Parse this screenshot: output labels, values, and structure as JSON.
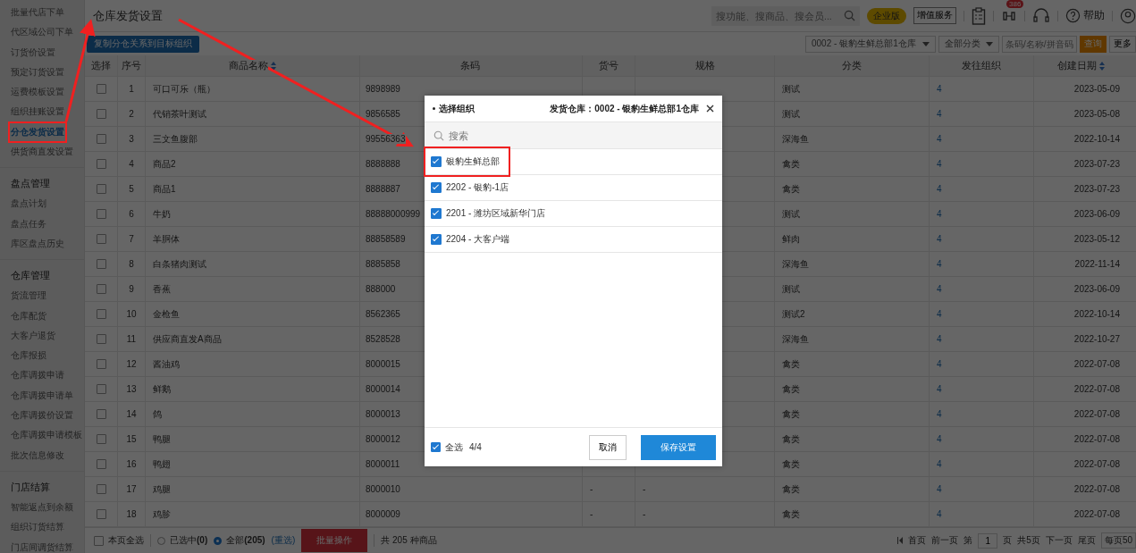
{
  "sidebar": {
    "groups": [
      {
        "items": [
          {
            "label": "批量代店下单",
            "selected": false
          },
          {
            "label": "代区域公司下单",
            "selected": false
          },
          {
            "label": "订货价设置",
            "selected": false
          },
          {
            "label": "预定订货设置",
            "selected": false
          },
          {
            "label": "运费模板设置",
            "selected": false
          },
          {
            "label": "组织挂账设置",
            "selected": false
          },
          {
            "label": "分仓发货设置",
            "selected": true
          },
          {
            "label": "供货商直发设置",
            "selected": false
          }
        ]
      },
      {
        "heading": "盘点管理",
        "items": [
          {
            "label": "盘点计划",
            "selected": false
          },
          {
            "label": "盘点任务",
            "selected": false
          },
          {
            "label": "库区盘点历史",
            "selected": false
          }
        ]
      },
      {
        "heading": "仓库管理",
        "items": [
          {
            "label": "货流管理",
            "selected": false
          },
          {
            "label": "仓库配货",
            "selected": false
          },
          {
            "label": "大客户退货",
            "selected": false
          },
          {
            "label": "仓库报损",
            "selected": false
          },
          {
            "label": "仓库调拨申请",
            "selected": false
          },
          {
            "label": "仓库调拨申请单",
            "selected": false
          },
          {
            "label": "仓库调拨价设置",
            "selected": false
          },
          {
            "label": "仓库调拨申请模板",
            "selected": false
          },
          {
            "label": "批次信息修改",
            "selected": false
          }
        ]
      },
      {
        "heading": "门店结算",
        "items": [
          {
            "label": "智能返点到余额",
            "selected": false
          },
          {
            "label": "组织订货结算",
            "selected": false
          },
          {
            "label": "门店间调货结算",
            "selected": false
          }
        ]
      }
    ]
  },
  "header": {
    "title": "仓库发货设置",
    "search": {
      "placeholder": "搜功能、搜商品、搜会员..."
    },
    "edition_badge": "企业版",
    "value_service": "增值服务",
    "notification_count": "386",
    "help": "帮助"
  },
  "toolbar": {
    "copy_button": "复制分仓关系到目标组织",
    "warehouse_select": "0002 - 银豹生鲜总部1仓库",
    "category_select": "全部分类",
    "keyword": {
      "placeholder": "条码/名称/拼音码"
    },
    "query_button": "查询",
    "more_button": "更多"
  },
  "table": {
    "columns": [
      "选择",
      "序号",
      "商品名称",
      "条码",
      "货号",
      "规格",
      "分类",
      "发往组织",
      "创建日期"
    ],
    "rows": [
      {
        "checked": false,
        "no": "1",
        "name": "可口可乐（瓶）",
        "barcode": "9898989",
        "category": "测试",
        "org": "4",
        "date": "2023-05-09"
      },
      {
        "checked": false,
        "no": "2",
        "name": "代销茶叶测试",
        "barcode": "9856585",
        "category": "测试",
        "org": "4",
        "date": "2023-05-08"
      },
      {
        "checked": false,
        "no": "3",
        "name": "三文鱼腹部",
        "barcode": "99556363",
        "category": "深海鱼",
        "org": "4",
        "date": "2022-10-14"
      },
      {
        "checked": false,
        "no": "4",
        "name": "商品2",
        "barcode": "8888888",
        "category": "禽类",
        "org": "4",
        "date": "2023-07-23"
      },
      {
        "checked": false,
        "no": "5",
        "name": "商品1",
        "barcode": "8888887",
        "category": "禽类",
        "org": "4",
        "date": "2023-07-23"
      },
      {
        "checked": false,
        "no": "6",
        "name": "牛奶",
        "barcode": "88888000999",
        "category": "测试",
        "org": "4",
        "date": "2023-06-09"
      },
      {
        "checked": false,
        "no": "7",
        "name": "羊胴体",
        "barcode": "88858589",
        "category": "鲜肉",
        "org": "4",
        "date": "2023-05-12"
      },
      {
        "checked": false,
        "no": "8",
        "name": "白条猪肉测试",
        "barcode": "8885858",
        "category": "深海鱼",
        "org": "4",
        "date": "2022-11-14"
      },
      {
        "checked": false,
        "no": "9",
        "name": "香蕉",
        "barcode": "888000",
        "category": "测试",
        "org": "4",
        "date": "2023-06-09"
      },
      {
        "checked": false,
        "no": "10",
        "name": "金枪鱼",
        "barcode": "8562365",
        "category": "测试2",
        "org": "4",
        "date": "2022-10-14"
      },
      {
        "checked": false,
        "no": "11",
        "name": "供应商直发A商品",
        "barcode": "8528528",
        "category": "深海鱼",
        "org": "4",
        "date": "2022-10-27"
      },
      {
        "checked": false,
        "no": "12",
        "name": "酱油鸡",
        "barcode": "8000015",
        "category": "禽类",
        "org": "4",
        "date": "2022-07-08"
      },
      {
        "checked": false,
        "no": "13",
        "name": "鲜鹅",
        "barcode": "8000014",
        "category": "禽类",
        "org": "4",
        "date": "2022-07-08"
      },
      {
        "checked": false,
        "no": "14",
        "name": "鸽",
        "barcode": "8000013",
        "category": "禽类",
        "org": "4",
        "date": "2022-07-08"
      },
      {
        "checked": false,
        "no": "15",
        "name": "鸭腿",
        "barcode": "8000012",
        "category": "禽类",
        "org": "4",
        "date": "2022-07-08"
      },
      {
        "checked": false,
        "no": "16",
        "name": "鸭翅",
        "barcode": "8000011",
        "category": "禽类",
        "org": "4",
        "date": "2022-07-08"
      },
      {
        "checked": false,
        "no": "17",
        "name": "鸡腿",
        "barcode": "8000010",
        "item_no": "-",
        "spec": "-",
        "category": "禽类",
        "org": "4",
        "date": "2022-07-08"
      },
      {
        "checked": false,
        "no": "18",
        "name": "鸡胗",
        "barcode": "8000009",
        "item_no": "-",
        "spec": "-",
        "category": "禽类",
        "org": "4",
        "date": "2022-07-08"
      }
    ]
  },
  "footer": {
    "page_select_all": {
      "label": "本页全选",
      "checked": false
    },
    "scope": [
      {
        "label": "已选中**(0)**",
        "selected": false
      },
      {
        "label": "全部**(205)**",
        "selected": true
      }
    ],
    "reselect": "(重选)",
    "batch_button": "批量操作",
    "total": "共 205 种商品",
    "pagination": {
      "first": "首页",
      "prev": "前一页",
      "page_prefix": "第",
      "page": "1",
      "page_suffix": "页",
      "pages": "共5页",
      "next": "下一页",
      "last": "尾页",
      "per_page": "每页50"
    }
  },
  "dialog": {
    "title": "选择组织",
    "warehouse": "发货仓库：0002 - 银豹生鲜总部1仓库",
    "search": {
      "placeholder": "搜索"
    },
    "orgs": [
      {
        "label": "银豹生鲜总部",
        "checked": true
      },
      {
        "label": "2202 - 银豹-1店",
        "checked": true
      },
      {
        "label": "2201 - 潍坊区域新华门店",
        "checked": true
      },
      {
        "label": "2204 - 大客户端",
        "checked": true
      }
    ],
    "select_all": {
      "label": "全选",
      "checked": true
    },
    "count": "4/4",
    "cancel": "取消",
    "save": "保存设置"
  }
}
